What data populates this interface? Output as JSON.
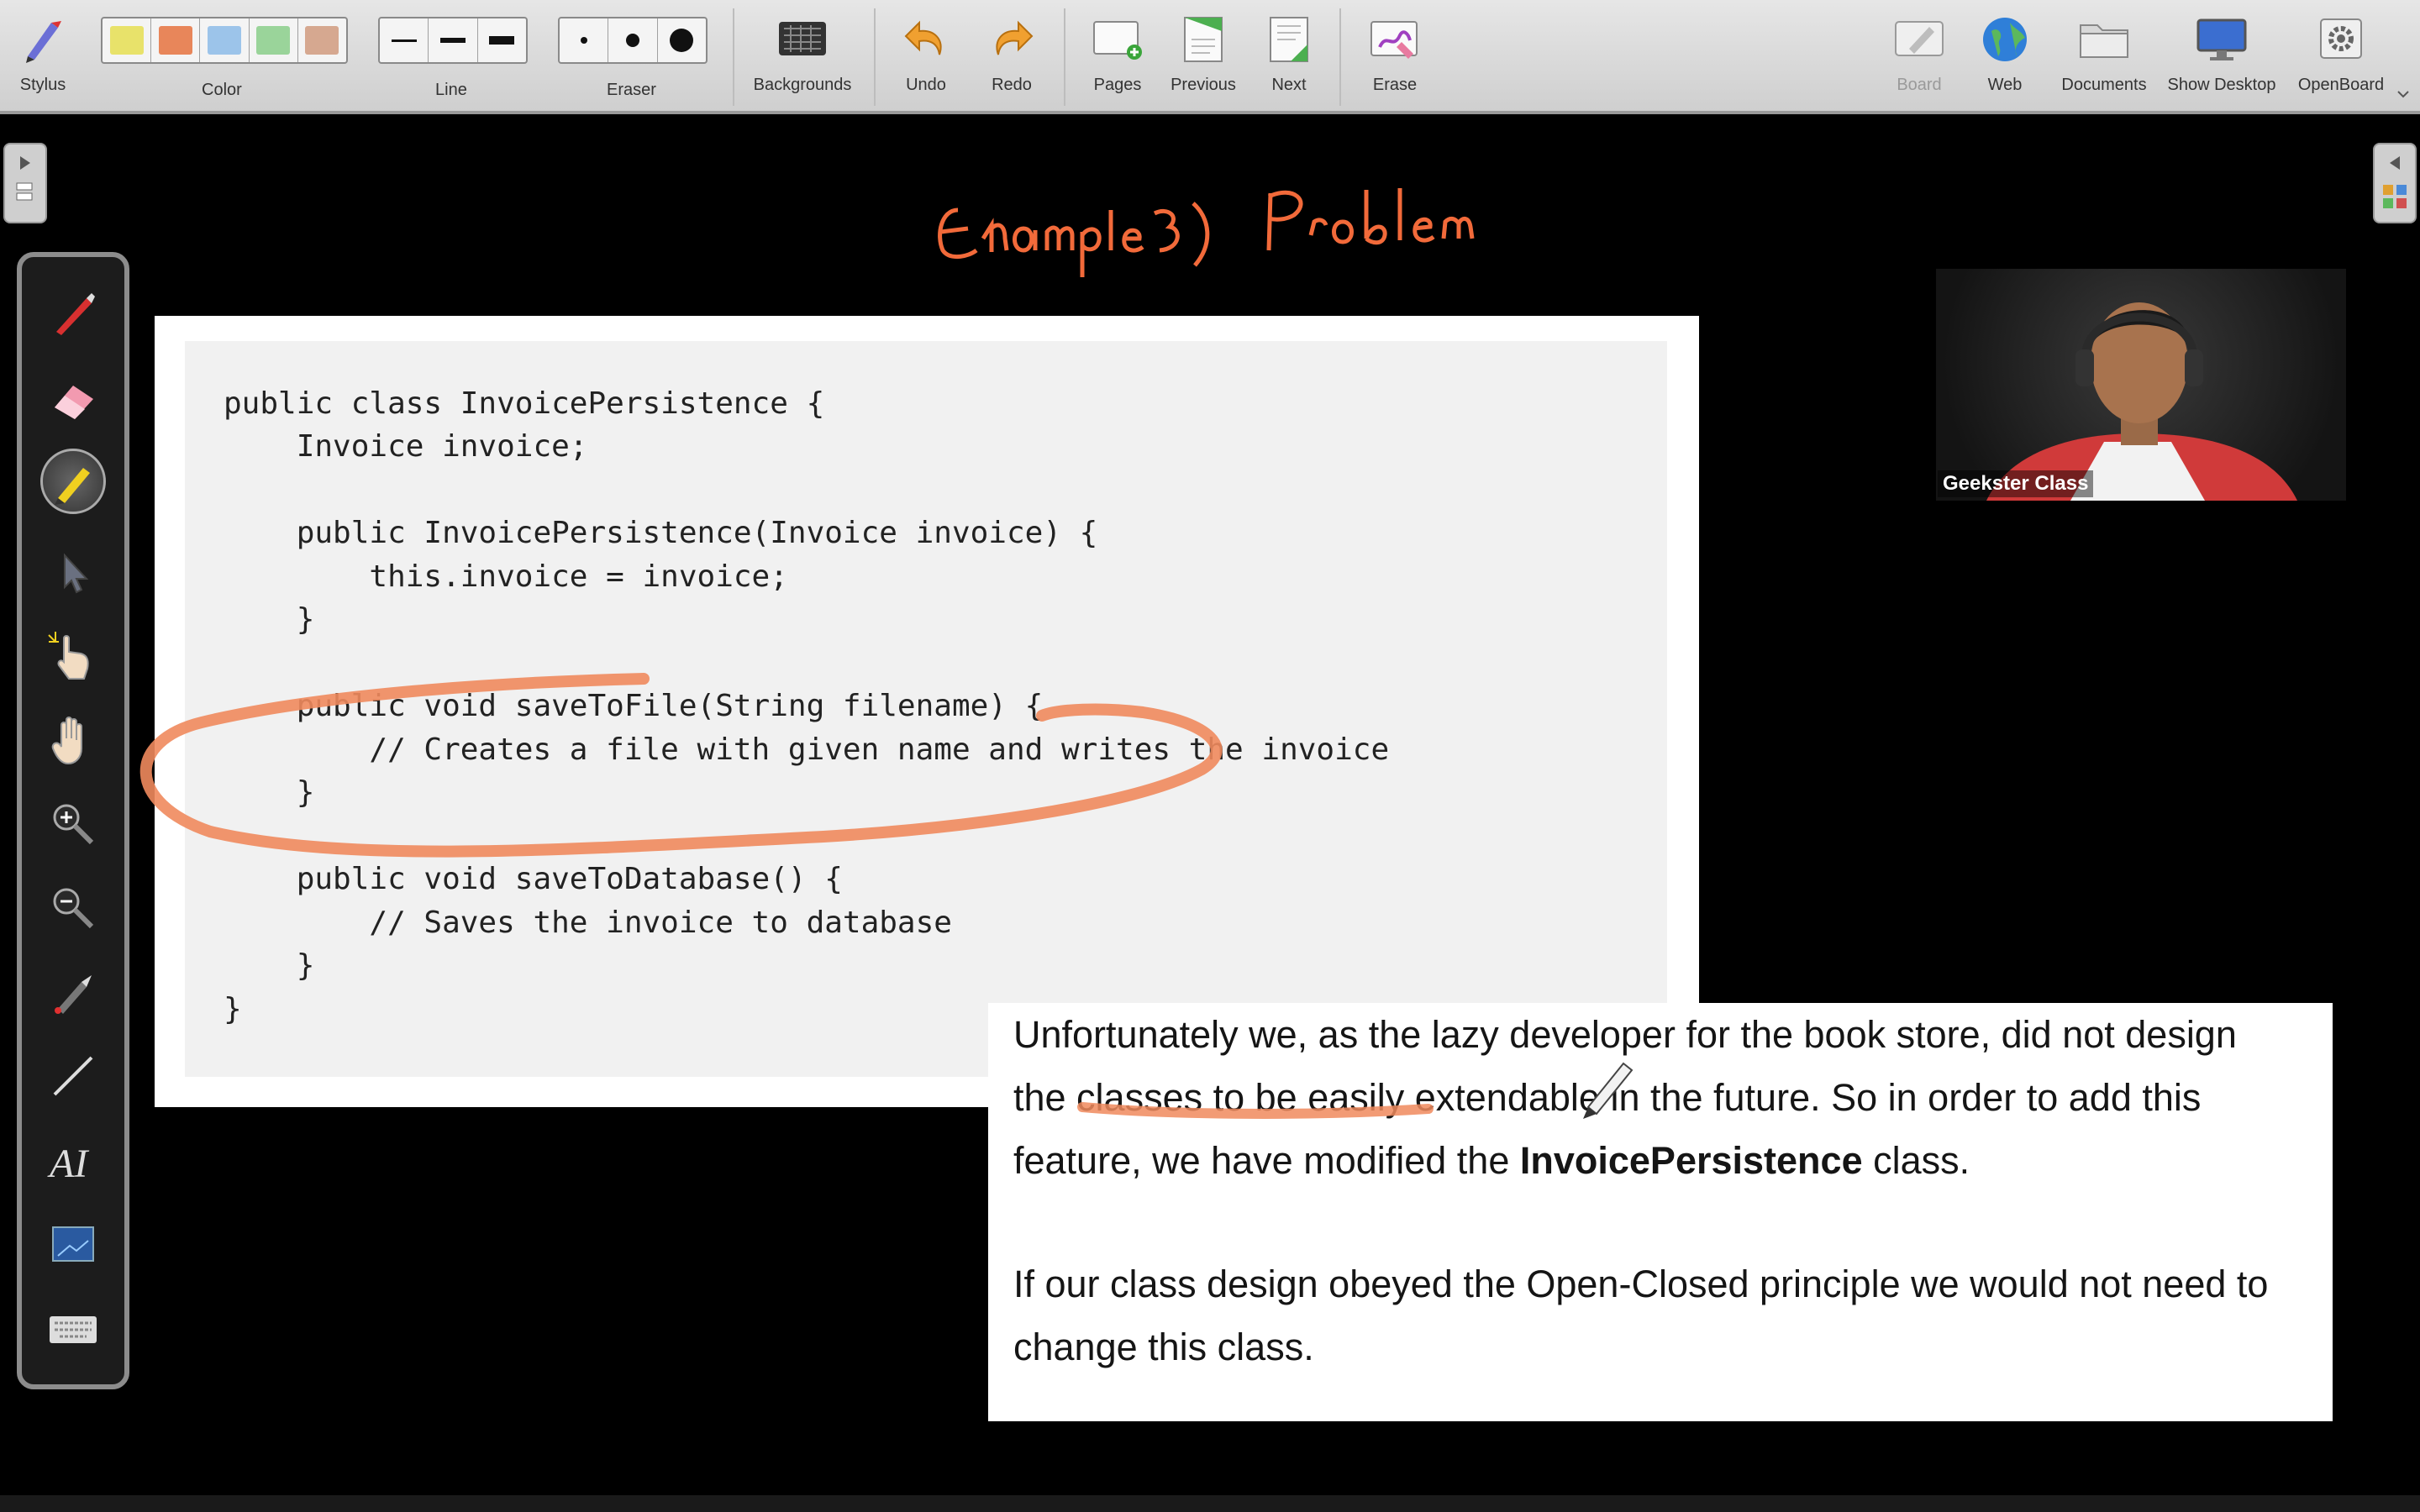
{
  "toolbar": {
    "stylus": "Stylus",
    "color": "Color",
    "line": "Line",
    "eraser": "Eraser",
    "backgrounds": "Backgrounds",
    "undo": "Undo",
    "redo": "Redo",
    "pages": "Pages",
    "previous": "Previous",
    "next": "Next",
    "erase": "Erase",
    "board": "Board",
    "web": "Web",
    "documents": "Documents",
    "show_desktop": "Show Desktop",
    "openboard": "OpenBoard"
  },
  "colors": {
    "swatches": [
      "#e8e26a",
      "#e8865a",
      "#9cc4ea",
      "#9ad49a",
      "#d6a890"
    ],
    "ink": "#f08a5d",
    "title_ink": "#f26a3a"
  },
  "annotation": {
    "title": "Example 3) Problem"
  },
  "code": {
    "lines": [
      "public class InvoicePersistence {",
      "    Invoice invoice;",
      "",
      "    public InvoicePersistence(Invoice invoice) {",
      "        this.invoice = invoice;",
      "    }",
      "",
      "    public void saveToFile(String filename) {",
      "        // Creates a file with given name and writes the invoice",
      "    }",
      "",
      "    public void saveToDatabase() {",
      "        // Saves the invoice to database",
      "    }",
      "}"
    ]
  },
  "text": {
    "p1_line1": "Unfortunately we, as the lazy developer for the book store, did not design",
    "p1_line2": "the classes to be easily extendable in the future. So in order to add this",
    "p1_line3_a": "feature, we have modified the ",
    "p1_line3_bold": "InvoicePersistence",
    "p1_line3_b": " class.",
    "p2_line1": "If our class design obeyed the Open-Closed principle we would not need to",
    "p2_line2": "change this class."
  },
  "webcam": {
    "name": "Geekster Class"
  }
}
